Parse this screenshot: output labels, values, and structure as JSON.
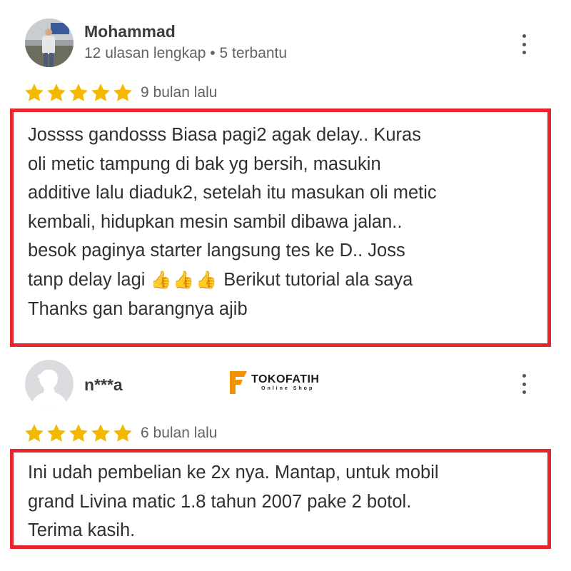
{
  "reviews": [
    {
      "name": "Mohammad",
      "meta": "12 ulasan lengkap • 5 terbantu",
      "rating": 5,
      "date": "9 bulan lalu",
      "text_part1": "Jossss gandosss Biasa pagi2 agak delay.. Kuras\noli metic tampung di bak yg bersih, masukin\nadditive lalu diaduk2, setelah itu masukan oli metic\nkembali, hidupkan mesin sambil dibawa jalan..\nbesok paginya starter langsung tes ke D.. Joss\ntanp delay lagi ",
      "emoji": "👍👍👍",
      "text_part2": " Berikut tutorial ala saya\nThanks gan barangnya ajib"
    },
    {
      "name": "n***a",
      "rating": 5,
      "date": "6 bulan lalu",
      "text": "Ini udah pembelian ke 2x nya. Mantap, untuk mobil\ngrand Livina matic 1.8 tahun 2007 pake 2 botol.\nTerima kasih."
    }
  ],
  "watermark": {
    "title": "TOKOFATIH",
    "subtitle": "Online Shop"
  },
  "colors": {
    "star": "#f5b800",
    "highlight_border": "#e8262e",
    "logo_accent": "#f39200"
  }
}
